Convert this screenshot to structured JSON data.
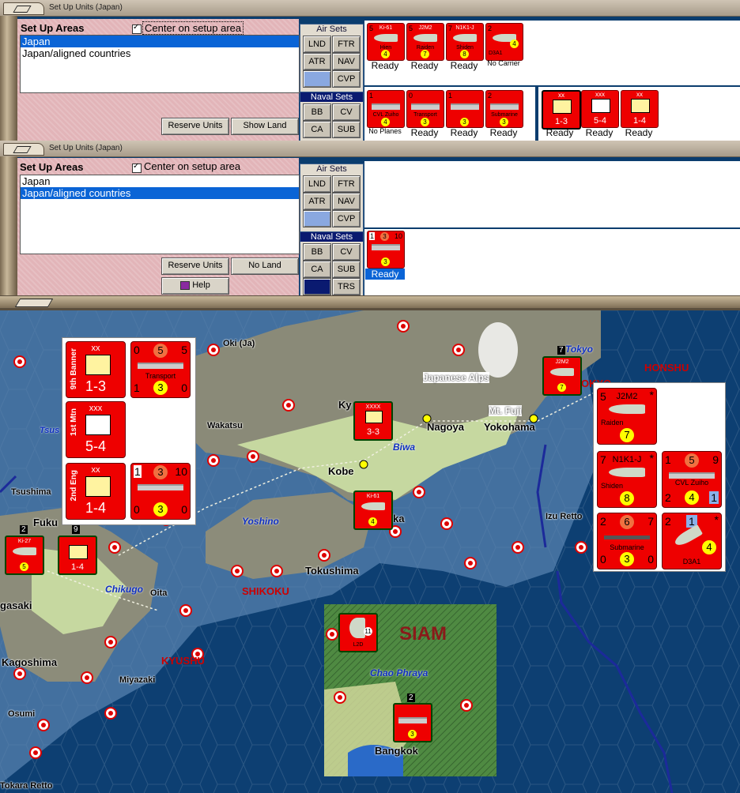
{
  "window1": {
    "title": "Set Up Units (Japan)",
    "setup_areas_label": "Set Up Areas",
    "center_label": "Center on setup area",
    "areas": [
      "Japan",
      "Japan/aligned countries"
    ],
    "selected_area": 0,
    "reserve_label": "Reserve Units",
    "showland_label": "Show Land",
    "air_sets_label": "Air Sets",
    "air_sets": [
      "LND",
      "FTR",
      "ATR",
      "NAV",
      "CVP"
    ],
    "naval_sets_label": "Naval Sets",
    "naval_sets": [
      "BB",
      "CV",
      "CA",
      "SUB"
    ],
    "air_counters": [
      {
        "name": "Ki-61",
        "sub": "Hien",
        "tl": "5",
        "v": "4",
        "status": "Ready"
      },
      {
        "name": "J2M2",
        "sub": "Raiden",
        "tl": "5",
        "v": "7",
        "status": "Ready"
      },
      {
        "name": "N1K1-J",
        "sub": "Shiden",
        "tl": "7",
        "v": "8",
        "status": "Ready"
      },
      {
        "name": "",
        "sub": "D3A1",
        "tl": "2",
        "v": "4",
        "status": "No Carrier"
      }
    ],
    "naval_counters": [
      {
        "sub": "CVL Zuiho",
        "tl": "1",
        "v": "4",
        "status": "No Planes"
      },
      {
        "sub": "Transport",
        "tl": "0",
        "v": "3",
        "status": "Ready"
      },
      {
        "sub": "",
        "tl": "1",
        "v": "3",
        "status": "Ready"
      },
      {
        "sub": "Submarine",
        "tl": "2",
        "v": "3",
        "status": "Ready"
      }
    ],
    "land_counters": [
      {
        "top": "xx",
        "side": "9th Banner",
        "val": "1-3",
        "status": "Ready"
      },
      {
        "top": "xxx",
        "side": "1st Mtn",
        "val": "5-4",
        "status": "Ready"
      },
      {
        "top": "xx",
        "side": "2nd Eng",
        "val": "1-4",
        "status": "Ready"
      }
    ]
  },
  "window2": {
    "title": "Set Up Units (Japan)",
    "setup_areas_label": "Set Up Areas",
    "center_label": "Center on setup area",
    "areas": [
      "Japan",
      "Japan/aligned countries"
    ],
    "selected_area": 1,
    "reserve_label": "Reserve Units",
    "noland_label": "No Land",
    "help_label": "Help",
    "air_sets_label": "Air Sets",
    "air_sets": [
      "LND",
      "FTR",
      "ATR",
      "NAV",
      "CVP"
    ],
    "naval_sets_label": "Naval Sets",
    "naval_sets": [
      "BB",
      "CV",
      "CA",
      "SUB",
      "TRS"
    ],
    "naval_counter": {
      "tl": "1",
      "mid": "3",
      "tr": "10",
      "v": "3",
      "status": "Ready"
    }
  },
  "map": {
    "labels": {
      "oki": "Oki (Ja)",
      "honshu": "HONSHU",
      "alps": "Japanese Alps",
      "fuji": "Mt. Fuji",
      "nagoya": "Nagoya",
      "yokohama": "Yokohama",
      "wakatsu": "Wakatsu",
      "biwa": "Biwa",
      "kobe": "Kobe",
      "tsushima": "Tsushima",
      "tsus": "Tsus",
      "fuku": "Fuku",
      "yoshino": "Yoshino",
      "izu": "Izu Retto",
      "tokushima": "Tokushima",
      "shikoku": "SHIKOKU",
      "chikugo": "Chikugo",
      "oita": "Oita",
      "gasaki": "gasaki",
      "kagoshima": "Kagoshima",
      "kyushu": "KYUSHU",
      "miyazaki": "Miyazaki",
      "osumi": "Osumi",
      "tokara": "Tokara Retto",
      "siam": "SIAM",
      "chao": "Chao Phraya",
      "bangkok": "Bangkok",
      "tokyo": "Tokyo",
      "tokyo_suffix": "OKYO",
      "ka": "ka",
      "ky": "Ky"
    },
    "popup_left": {
      "c1": {
        "top": "xx",
        "side": "9th Banner",
        "val": "1-3"
      },
      "c2": {
        "tl": "0",
        "mid": "5",
        "tr": "5",
        "cap": "Transport",
        "bl": "1",
        "v": "3",
        "br": "0"
      },
      "c3": {
        "top": "xxx",
        "side": "1st Mtn",
        "val": "5-4"
      },
      "c4": {
        "top": "xx",
        "side": "2nd Eng",
        "val": "1-4"
      },
      "c5": {
        "tl": "1",
        "mid": "3",
        "tr": "10",
        "bl": "0",
        "v": "3",
        "br": "0"
      }
    },
    "popup_right": {
      "c1": {
        "tl": "5",
        "name": "J2M2",
        "cap": "Raiden",
        "v": "7",
        "star": "*"
      },
      "c2": {
        "tl": "7",
        "name": "N1K1-J",
        "cap": "Shiden",
        "v": "8",
        "star": "*"
      },
      "c3": {
        "tl": "1",
        "mid": "5",
        "tr": "9",
        "cap": "CVL Zuiho",
        "bl": "2",
        "v": "4",
        "br": "1"
      },
      "c4": {
        "tl": "2",
        "mid": "6",
        "tr": "7",
        "cap": "Submarine",
        "bl": "0",
        "v": "3",
        "br": "0"
      },
      "c5": {
        "tl": "2",
        "mid": "1",
        "cap": "D3A1",
        "v": "4",
        "star": "*"
      }
    },
    "unit_nums": {
      "n7": "7",
      "n2": "2",
      "n9": "9",
      "n2b": "2",
      "n11": "11",
      "n5": "5"
    },
    "map_counters": {
      "m1": "Ki-61",
      "m2": "J2M2",
      "m3": "XXXX",
      "m3val": "3-3",
      "m4": "Ki-61",
      "m5": "Ki-27",
      "m6": "1-4",
      "m7": "L2D",
      "m8": "3"
    }
  }
}
